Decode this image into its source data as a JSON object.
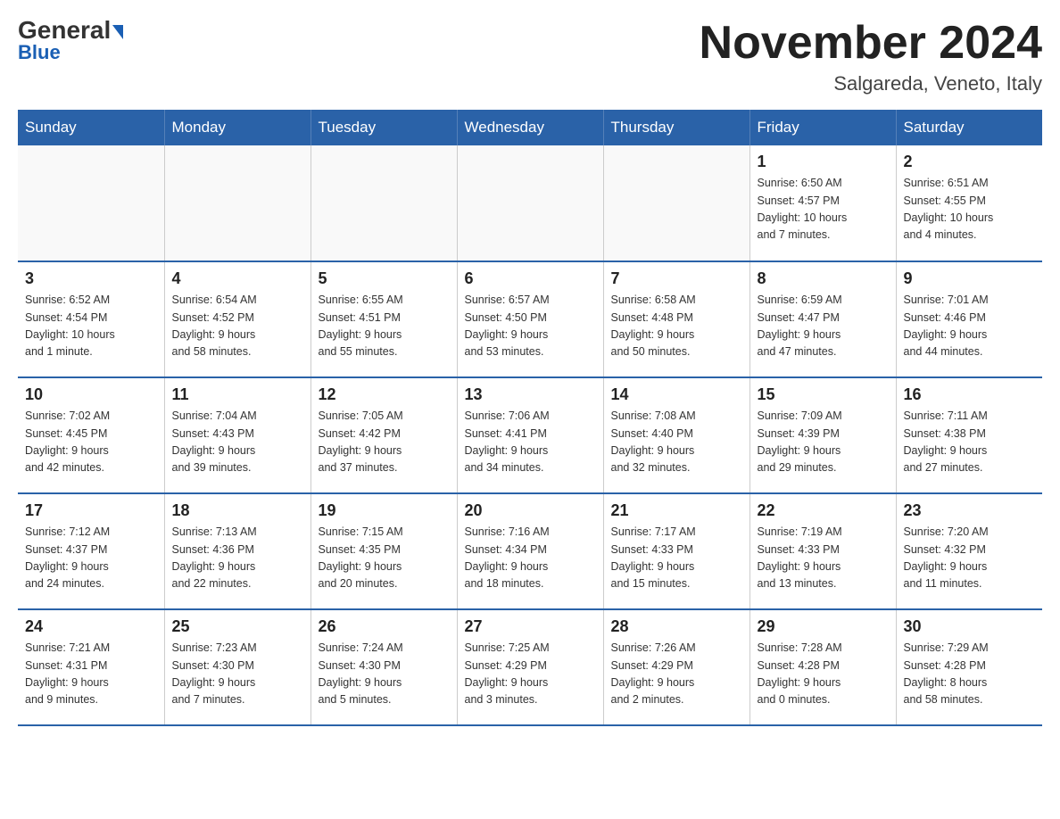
{
  "logo": {
    "text_general": "General",
    "text_blue": "Blue"
  },
  "title": {
    "month_year": "November 2024",
    "location": "Salgareda, Veneto, Italy"
  },
  "days_of_week": [
    "Sunday",
    "Monday",
    "Tuesday",
    "Wednesday",
    "Thursday",
    "Friday",
    "Saturday"
  ],
  "weeks": [
    [
      {
        "day": "",
        "info": ""
      },
      {
        "day": "",
        "info": ""
      },
      {
        "day": "",
        "info": ""
      },
      {
        "day": "",
        "info": ""
      },
      {
        "day": "",
        "info": ""
      },
      {
        "day": "1",
        "info": "Sunrise: 6:50 AM\nSunset: 4:57 PM\nDaylight: 10 hours\nand 7 minutes."
      },
      {
        "day": "2",
        "info": "Sunrise: 6:51 AM\nSunset: 4:55 PM\nDaylight: 10 hours\nand 4 minutes."
      }
    ],
    [
      {
        "day": "3",
        "info": "Sunrise: 6:52 AM\nSunset: 4:54 PM\nDaylight: 10 hours\nand 1 minute."
      },
      {
        "day": "4",
        "info": "Sunrise: 6:54 AM\nSunset: 4:52 PM\nDaylight: 9 hours\nand 58 minutes."
      },
      {
        "day": "5",
        "info": "Sunrise: 6:55 AM\nSunset: 4:51 PM\nDaylight: 9 hours\nand 55 minutes."
      },
      {
        "day": "6",
        "info": "Sunrise: 6:57 AM\nSunset: 4:50 PM\nDaylight: 9 hours\nand 53 minutes."
      },
      {
        "day": "7",
        "info": "Sunrise: 6:58 AM\nSunset: 4:48 PM\nDaylight: 9 hours\nand 50 minutes."
      },
      {
        "day": "8",
        "info": "Sunrise: 6:59 AM\nSunset: 4:47 PM\nDaylight: 9 hours\nand 47 minutes."
      },
      {
        "day": "9",
        "info": "Sunrise: 7:01 AM\nSunset: 4:46 PM\nDaylight: 9 hours\nand 44 minutes."
      }
    ],
    [
      {
        "day": "10",
        "info": "Sunrise: 7:02 AM\nSunset: 4:45 PM\nDaylight: 9 hours\nand 42 minutes."
      },
      {
        "day": "11",
        "info": "Sunrise: 7:04 AM\nSunset: 4:43 PM\nDaylight: 9 hours\nand 39 minutes."
      },
      {
        "day": "12",
        "info": "Sunrise: 7:05 AM\nSunset: 4:42 PM\nDaylight: 9 hours\nand 37 minutes."
      },
      {
        "day": "13",
        "info": "Sunrise: 7:06 AM\nSunset: 4:41 PM\nDaylight: 9 hours\nand 34 minutes."
      },
      {
        "day": "14",
        "info": "Sunrise: 7:08 AM\nSunset: 4:40 PM\nDaylight: 9 hours\nand 32 minutes."
      },
      {
        "day": "15",
        "info": "Sunrise: 7:09 AM\nSunset: 4:39 PM\nDaylight: 9 hours\nand 29 minutes."
      },
      {
        "day": "16",
        "info": "Sunrise: 7:11 AM\nSunset: 4:38 PM\nDaylight: 9 hours\nand 27 minutes."
      }
    ],
    [
      {
        "day": "17",
        "info": "Sunrise: 7:12 AM\nSunset: 4:37 PM\nDaylight: 9 hours\nand 24 minutes."
      },
      {
        "day": "18",
        "info": "Sunrise: 7:13 AM\nSunset: 4:36 PM\nDaylight: 9 hours\nand 22 minutes."
      },
      {
        "day": "19",
        "info": "Sunrise: 7:15 AM\nSunset: 4:35 PM\nDaylight: 9 hours\nand 20 minutes."
      },
      {
        "day": "20",
        "info": "Sunrise: 7:16 AM\nSunset: 4:34 PM\nDaylight: 9 hours\nand 18 minutes."
      },
      {
        "day": "21",
        "info": "Sunrise: 7:17 AM\nSunset: 4:33 PM\nDaylight: 9 hours\nand 15 minutes."
      },
      {
        "day": "22",
        "info": "Sunrise: 7:19 AM\nSunset: 4:33 PM\nDaylight: 9 hours\nand 13 minutes."
      },
      {
        "day": "23",
        "info": "Sunrise: 7:20 AM\nSunset: 4:32 PM\nDaylight: 9 hours\nand 11 minutes."
      }
    ],
    [
      {
        "day": "24",
        "info": "Sunrise: 7:21 AM\nSunset: 4:31 PM\nDaylight: 9 hours\nand 9 minutes."
      },
      {
        "day": "25",
        "info": "Sunrise: 7:23 AM\nSunset: 4:30 PM\nDaylight: 9 hours\nand 7 minutes."
      },
      {
        "day": "26",
        "info": "Sunrise: 7:24 AM\nSunset: 4:30 PM\nDaylight: 9 hours\nand 5 minutes."
      },
      {
        "day": "27",
        "info": "Sunrise: 7:25 AM\nSunset: 4:29 PM\nDaylight: 9 hours\nand 3 minutes."
      },
      {
        "day": "28",
        "info": "Sunrise: 7:26 AM\nSunset: 4:29 PM\nDaylight: 9 hours\nand 2 minutes."
      },
      {
        "day": "29",
        "info": "Sunrise: 7:28 AM\nSunset: 4:28 PM\nDaylight: 9 hours\nand 0 minutes."
      },
      {
        "day": "30",
        "info": "Sunrise: 7:29 AM\nSunset: 4:28 PM\nDaylight: 8 hours\nand 58 minutes."
      }
    ]
  ]
}
